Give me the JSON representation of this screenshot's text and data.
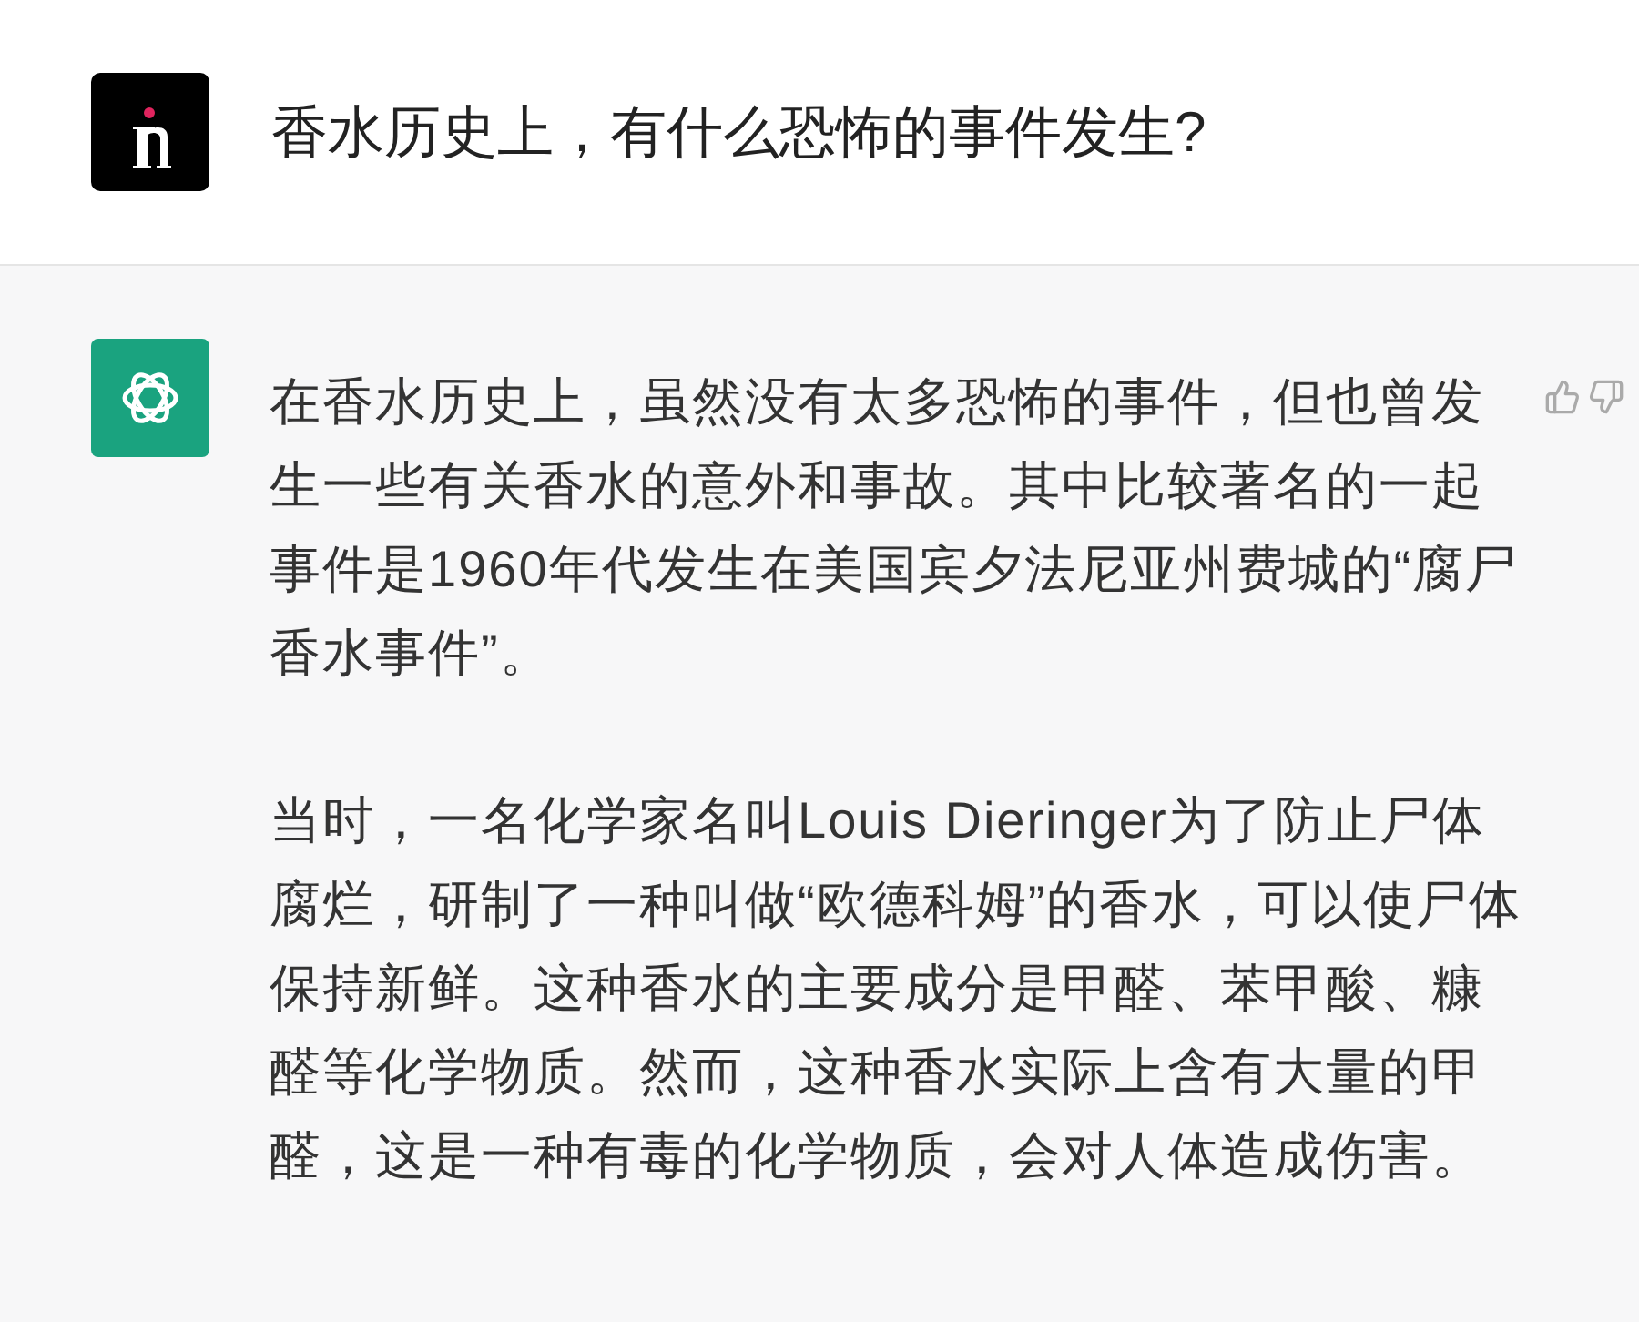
{
  "question": {
    "text": "香水历史上，有什么恐怖的事件发生?"
  },
  "answer": {
    "paragraphs": [
      "在香水历史上，虽然没有太多恐怖的事件，但也曾发生一些有关香水的意外和事故。其中比较著名的一起事件是1960年代发生在美国宾夕法尼亚州费城的“腐尸香水事件”。",
      "当时，一名化学家名叫Louis Dieringer为了防止尸体腐烂，研制了一种叫做“欧德科姆”的香水，可以使尸体保持新鲜。这种香水的主要成分是甲醛、苯甲酸、糠醛等化学物质。然而，这种香水实际上含有大量的甲醛，这是一种有毒的化学物质，会对人体造成伤害。"
    ]
  }
}
